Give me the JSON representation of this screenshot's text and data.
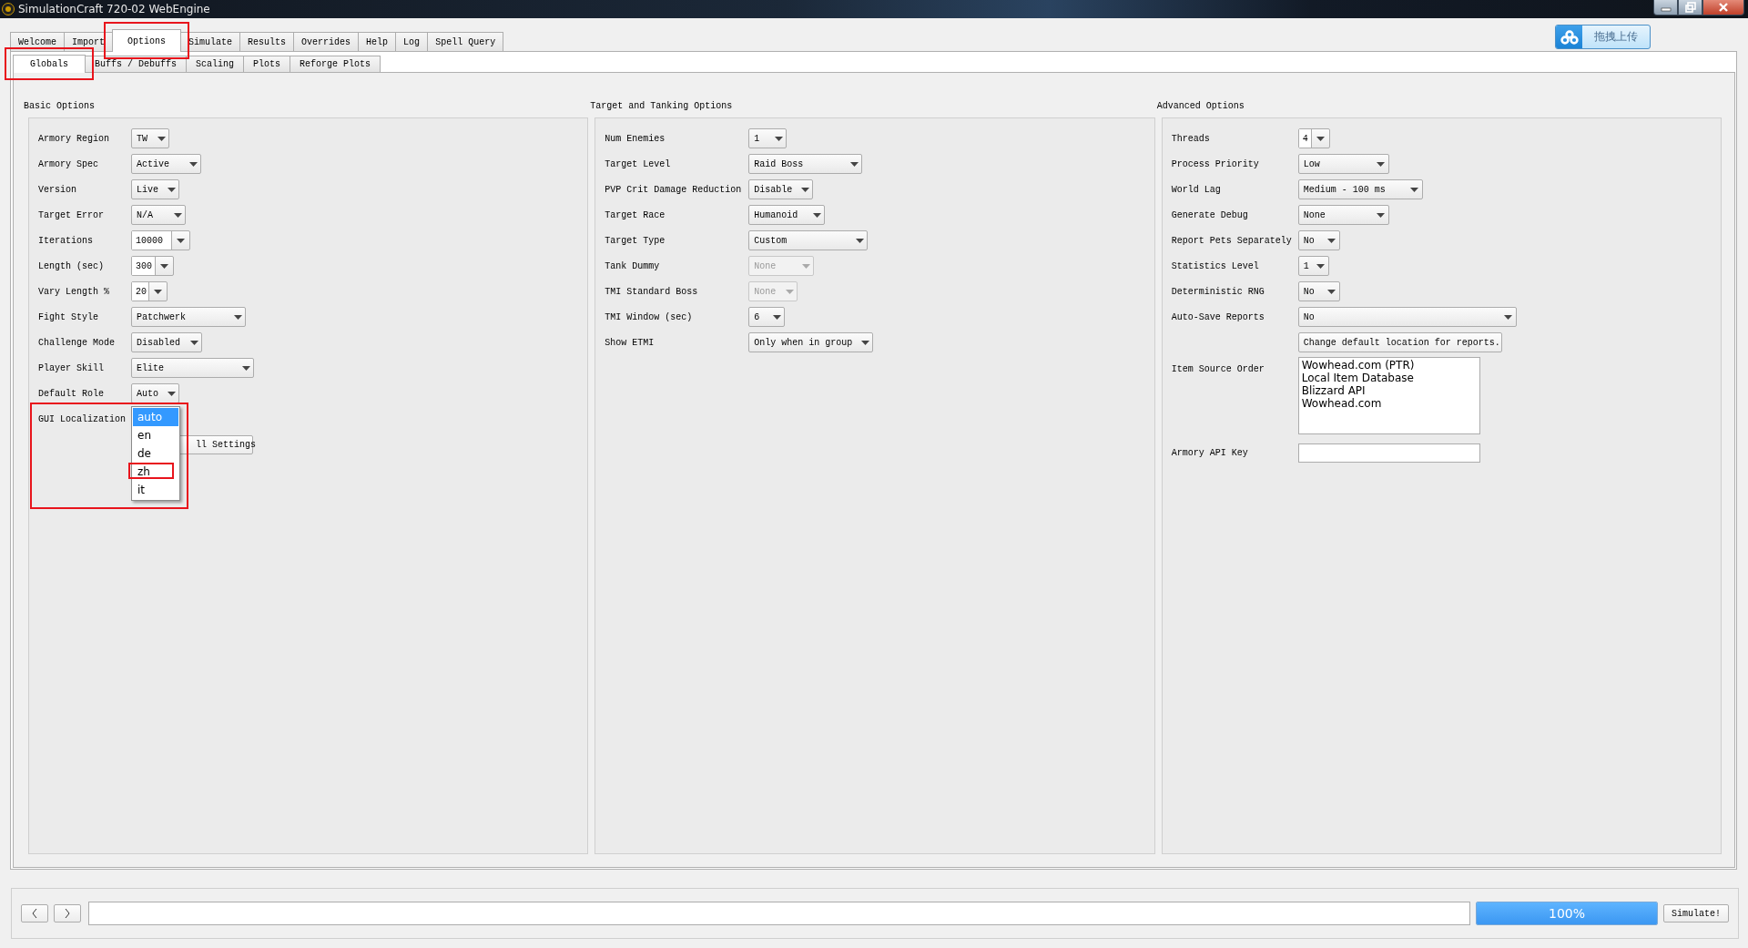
{
  "window": {
    "title": "SimulationCraft 720-02 WebEngine"
  },
  "upload_button": {
    "label": "拖拽上传"
  },
  "tabs": [
    {
      "label": "Welcome",
      "selected": false,
      "highlighted": false
    },
    {
      "label": "Import",
      "selected": false,
      "highlighted": false
    },
    {
      "label": "Options",
      "selected": true,
      "highlighted": true
    },
    {
      "label": "Simulate",
      "selected": false,
      "highlighted": false
    },
    {
      "label": "Results",
      "selected": false,
      "highlighted": false
    },
    {
      "label": "Overrides",
      "selected": false,
      "highlighted": false
    },
    {
      "label": "Help",
      "selected": false,
      "highlighted": false
    },
    {
      "label": "Log",
      "selected": false,
      "highlighted": false
    },
    {
      "label": "Spell Query",
      "selected": false,
      "highlighted": false
    }
  ],
  "subtabs": [
    {
      "label": "Globals",
      "selected": true,
      "highlighted": true
    },
    {
      "label": "Buffs / Debuffs",
      "selected": false,
      "highlighted": false
    },
    {
      "label": "Scaling",
      "selected": false,
      "highlighted": false
    },
    {
      "label": "Plots",
      "selected": false,
      "highlighted": false
    },
    {
      "label": "Reforge Plots",
      "selected": false,
      "highlighted": false
    }
  ],
  "groups": [
    {
      "title": "Basic Options",
      "rows": [
        {
          "kind": "select",
          "label": "Armory Region",
          "value": "TW",
          "disabled": false,
          "highlighted": false
        },
        {
          "kind": "select",
          "label": "Armory Spec",
          "value": "Active",
          "disabled": false,
          "highlighted": false
        },
        {
          "kind": "select",
          "label": "Version",
          "value": "Live",
          "disabled": false,
          "highlighted": false
        },
        {
          "kind": "select",
          "label": "Target Error",
          "value": "N/A",
          "disabled": false,
          "highlighted": false
        },
        {
          "kind": "editable",
          "label": "Iterations",
          "value": "10000",
          "disabled": false,
          "highlighted": false
        },
        {
          "kind": "editable",
          "label": "Length (sec)",
          "value": "300",
          "disabled": false,
          "highlighted": false
        },
        {
          "kind": "editable",
          "label": "Vary Length %",
          "value": "20",
          "disabled": false,
          "highlighted": false
        },
        {
          "kind": "select",
          "label": "Fight Style",
          "value": "Patchwerk",
          "disabled": false,
          "highlighted": false
        },
        {
          "kind": "select",
          "label": "Challenge Mode",
          "value": "Disabled",
          "disabled": false,
          "highlighted": false
        },
        {
          "kind": "select",
          "label": "Player Skill",
          "value": "Elite",
          "disabled": false,
          "highlighted": false
        },
        {
          "kind": "select",
          "label": "Default Role",
          "value": "Auto",
          "disabled": false,
          "highlighted": false
        },
        {
          "kind": "open-select",
          "label": "GUI Localization",
          "disabled": false,
          "highlighted": true,
          "options": [
            {
              "label": "auto",
              "selected": true,
              "highlighted": false
            },
            {
              "label": "en",
              "selected": false,
              "highlighted": false
            },
            {
              "label": "de",
              "selected": false,
              "highlighted": false
            },
            {
              "label": "zh",
              "selected": false,
              "highlighted": true
            },
            {
              "label": "it",
              "selected": false,
              "highlighted": false
            }
          ]
        },
        {
          "kind": "covered-button",
          "value": "ll Settings",
          "disabled": false,
          "highlighted": false
        }
      ]
    },
    {
      "title": "Target and Tanking Options",
      "rows": [
        {
          "kind": "select",
          "label": "Num Enemies",
          "value": "1",
          "disabled": false,
          "highlighted": false
        },
        {
          "kind": "select",
          "label": "Target Level",
          "value": "Raid Boss",
          "disabled": false,
          "highlighted": false
        },
        {
          "kind": "select",
          "label": "PVP Crit Damage Reduction",
          "value": "Disable",
          "disabled": false,
          "highlighted": false
        },
        {
          "kind": "select",
          "label": "Target Race",
          "value": "Humanoid",
          "disabled": false,
          "highlighted": false
        },
        {
          "kind": "select",
          "label": "Target Type",
          "value": "Custom",
          "disabled": false,
          "highlighted": false
        },
        {
          "kind": "select",
          "label": "Tank Dummy",
          "value": "None",
          "disabled": true,
          "highlighted": false
        },
        {
          "kind": "select",
          "label": "TMI Standard Boss",
          "value": "None",
          "disabled": true,
          "highlighted": false
        },
        {
          "kind": "select",
          "label": "TMI Window (sec)",
          "value": "6",
          "disabled": false,
          "highlighted": false
        },
        {
          "kind": "select",
          "label": "Show ETMI",
          "value": "Only when in group",
          "disabled": false,
          "highlighted": false
        }
      ]
    },
    {
      "title": "Advanced Options",
      "rows": [
        {
          "kind": "editable",
          "label": "Threads",
          "value": "4",
          "disabled": false,
          "highlighted": false
        },
        {
          "kind": "select",
          "label": "Process Priority",
          "value": "Low",
          "disabled": false,
          "highlighted": false
        },
        {
          "kind": "select",
          "label": "World Lag",
          "value": "Medium - 100 ms",
          "disabled": false,
          "highlighted": false
        },
        {
          "kind": "select",
          "label": "Generate Debug",
          "value": "None",
          "disabled": false,
          "highlighted": false
        },
        {
          "kind": "select",
          "label": "Report Pets Separately",
          "value": "No",
          "disabled": false,
          "highlighted": false
        },
        {
          "kind": "select",
          "label": "Statistics Level",
          "value": "1",
          "disabled": false,
          "highlighted": false
        },
        {
          "kind": "select",
          "label": "Deterministic RNG",
          "value": "No",
          "disabled": false,
          "highlighted": false
        },
        {
          "kind": "select",
          "label": "Auto-Save Reports",
          "value": "No",
          "disabled": false,
          "highlighted": false
        },
        {
          "kind": "button",
          "value": "Change default location for reports.",
          "disabled": false,
          "highlighted": false
        },
        {
          "kind": "list",
          "label": "Item Source Order",
          "items": [
            "Wowhead.com (PTR)",
            "Local Item Database",
            "Blizzard API",
            "Wowhead.com"
          ],
          "disabled": false,
          "highlighted": false
        },
        {
          "kind": "field",
          "label": "Armory API Key",
          "disabled": false,
          "highlighted": false
        }
      ]
    }
  ],
  "bottom": {
    "progress": {
      "level": 1,
      "reading": "100%"
    },
    "simulate_button": "Simulate!"
  }
}
